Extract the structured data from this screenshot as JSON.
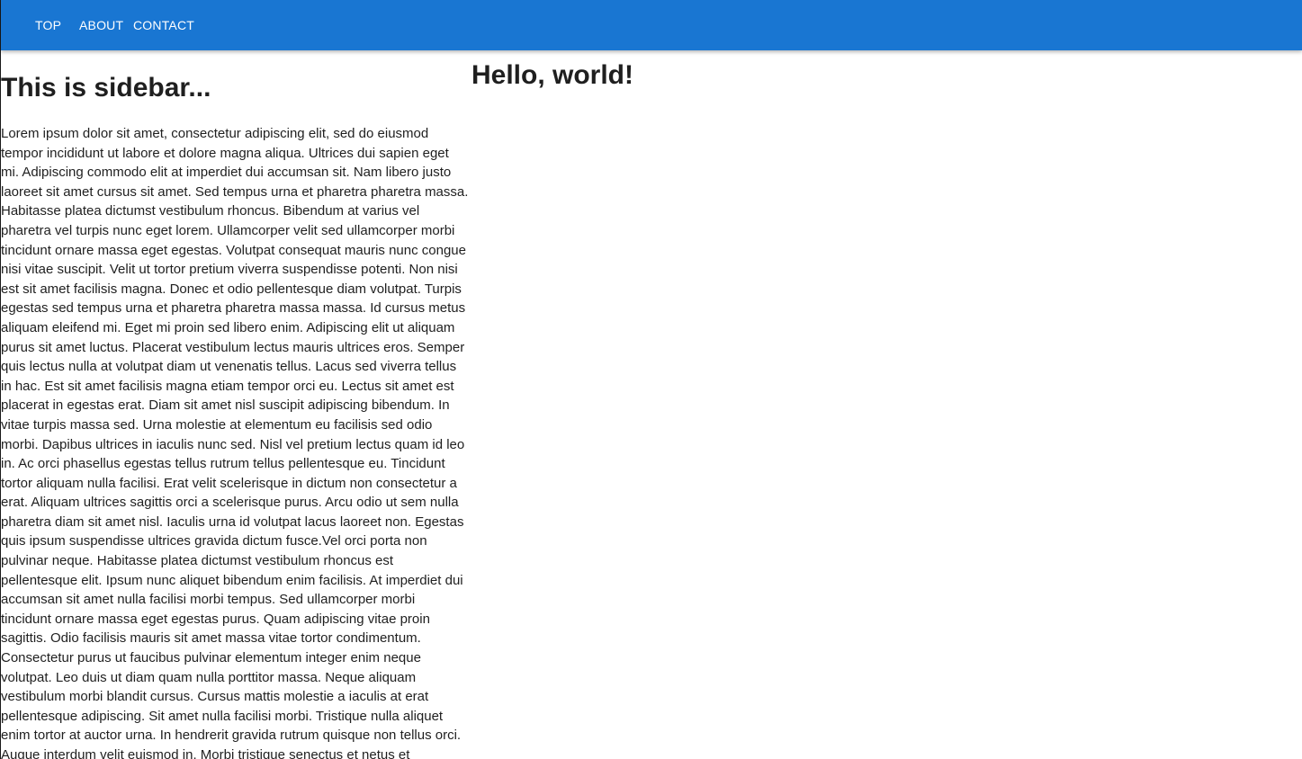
{
  "appbar": {
    "nav": [
      {
        "label": "TOP"
      },
      {
        "label": "ABOUT"
      },
      {
        "label": "CONTACT"
      }
    ],
    "color": "#1976d2"
  },
  "sidebar": {
    "title": "This is sidebar...",
    "body": "Lorem ipsum dolor sit amet, consectetur adipiscing elit, sed do eiusmod tempor incididunt ut labore et dolore magna aliqua. Ultrices dui sapien eget mi. Adipiscing commodo elit at imperdiet dui accumsan sit. Nam libero justo laoreet sit amet cursus sit amet. Sed tempus urna et pharetra pharetra massa. Habitasse platea dictumst vestibulum rhoncus. Bibendum at varius vel pharetra vel turpis nunc eget lorem. Ullamcorper velit sed ullamcorper morbi tincidunt ornare massa eget egestas. Volutpat consequat mauris nunc congue nisi vitae suscipit. Velit ut tortor pretium viverra suspendisse potenti. Non nisi est sit amet facilisis magna. Donec et odio pellentesque diam volutpat. Turpis egestas sed tempus urna et pharetra pharetra massa massa. Id cursus metus aliquam eleifend mi. Eget mi proin sed libero enim. Adipiscing elit ut aliquam purus sit amet luctus. Placerat vestibulum lectus mauris ultrices eros. Semper quis lectus nulla at volutpat diam ut venenatis tellus. Lacus sed viverra tellus in hac. Est sit amet facilisis magna etiam tempor orci eu. Lectus sit amet est placerat in egestas erat. Diam sit amet nisl suscipit adipiscing bibendum. In vitae turpis massa sed. Urna molestie at elementum eu facilisis sed odio morbi. Dapibus ultrices in iaculis nunc sed. Nisl vel pretium lectus quam id leo in. Ac orci phasellus egestas tellus rutrum tellus pellentesque eu. Tincidunt tortor aliquam nulla facilisi. Erat velit scelerisque in dictum non consectetur a erat. Aliquam ultrices sagittis orci a scelerisque purus. Arcu odio ut sem nulla pharetra diam sit amet nisl. Iaculis urna id volutpat lacus laoreet non. Egestas quis ipsum suspendisse ultrices gravida dictum fusce.Vel orci porta non pulvinar neque. Habitasse platea dictumst vestibulum rhoncus est pellentesque elit. Ipsum nunc aliquet bibendum enim facilisis. At imperdiet dui accumsan sit amet nulla facilisi morbi tempus. Sed ullamcorper morbi tincidunt ornare massa eget egestas purus. Quam adipiscing vitae proin sagittis. Odio facilisis mauris sit amet massa vitae tortor condimentum. Consectetur purus ut faucibus pulvinar elementum integer enim neque volutpat. Leo duis ut diam quam nulla porttitor massa. Neque aliquam vestibulum morbi blandit cursus. Cursus mattis molestie a iaculis at erat pellentesque adipiscing. Sit amet nulla facilisi morbi. Tristique nulla aliquet enim tortor at auctor urna. In hendrerit gravida rutrum quisque non tellus orci. Augue interdum velit euismod in. Morbi tristique senectus et netus et malesuada fames ac.Erat nam at lectus urna duis convallis convallis. Tristique"
  },
  "main": {
    "title": "Hello, world!"
  }
}
